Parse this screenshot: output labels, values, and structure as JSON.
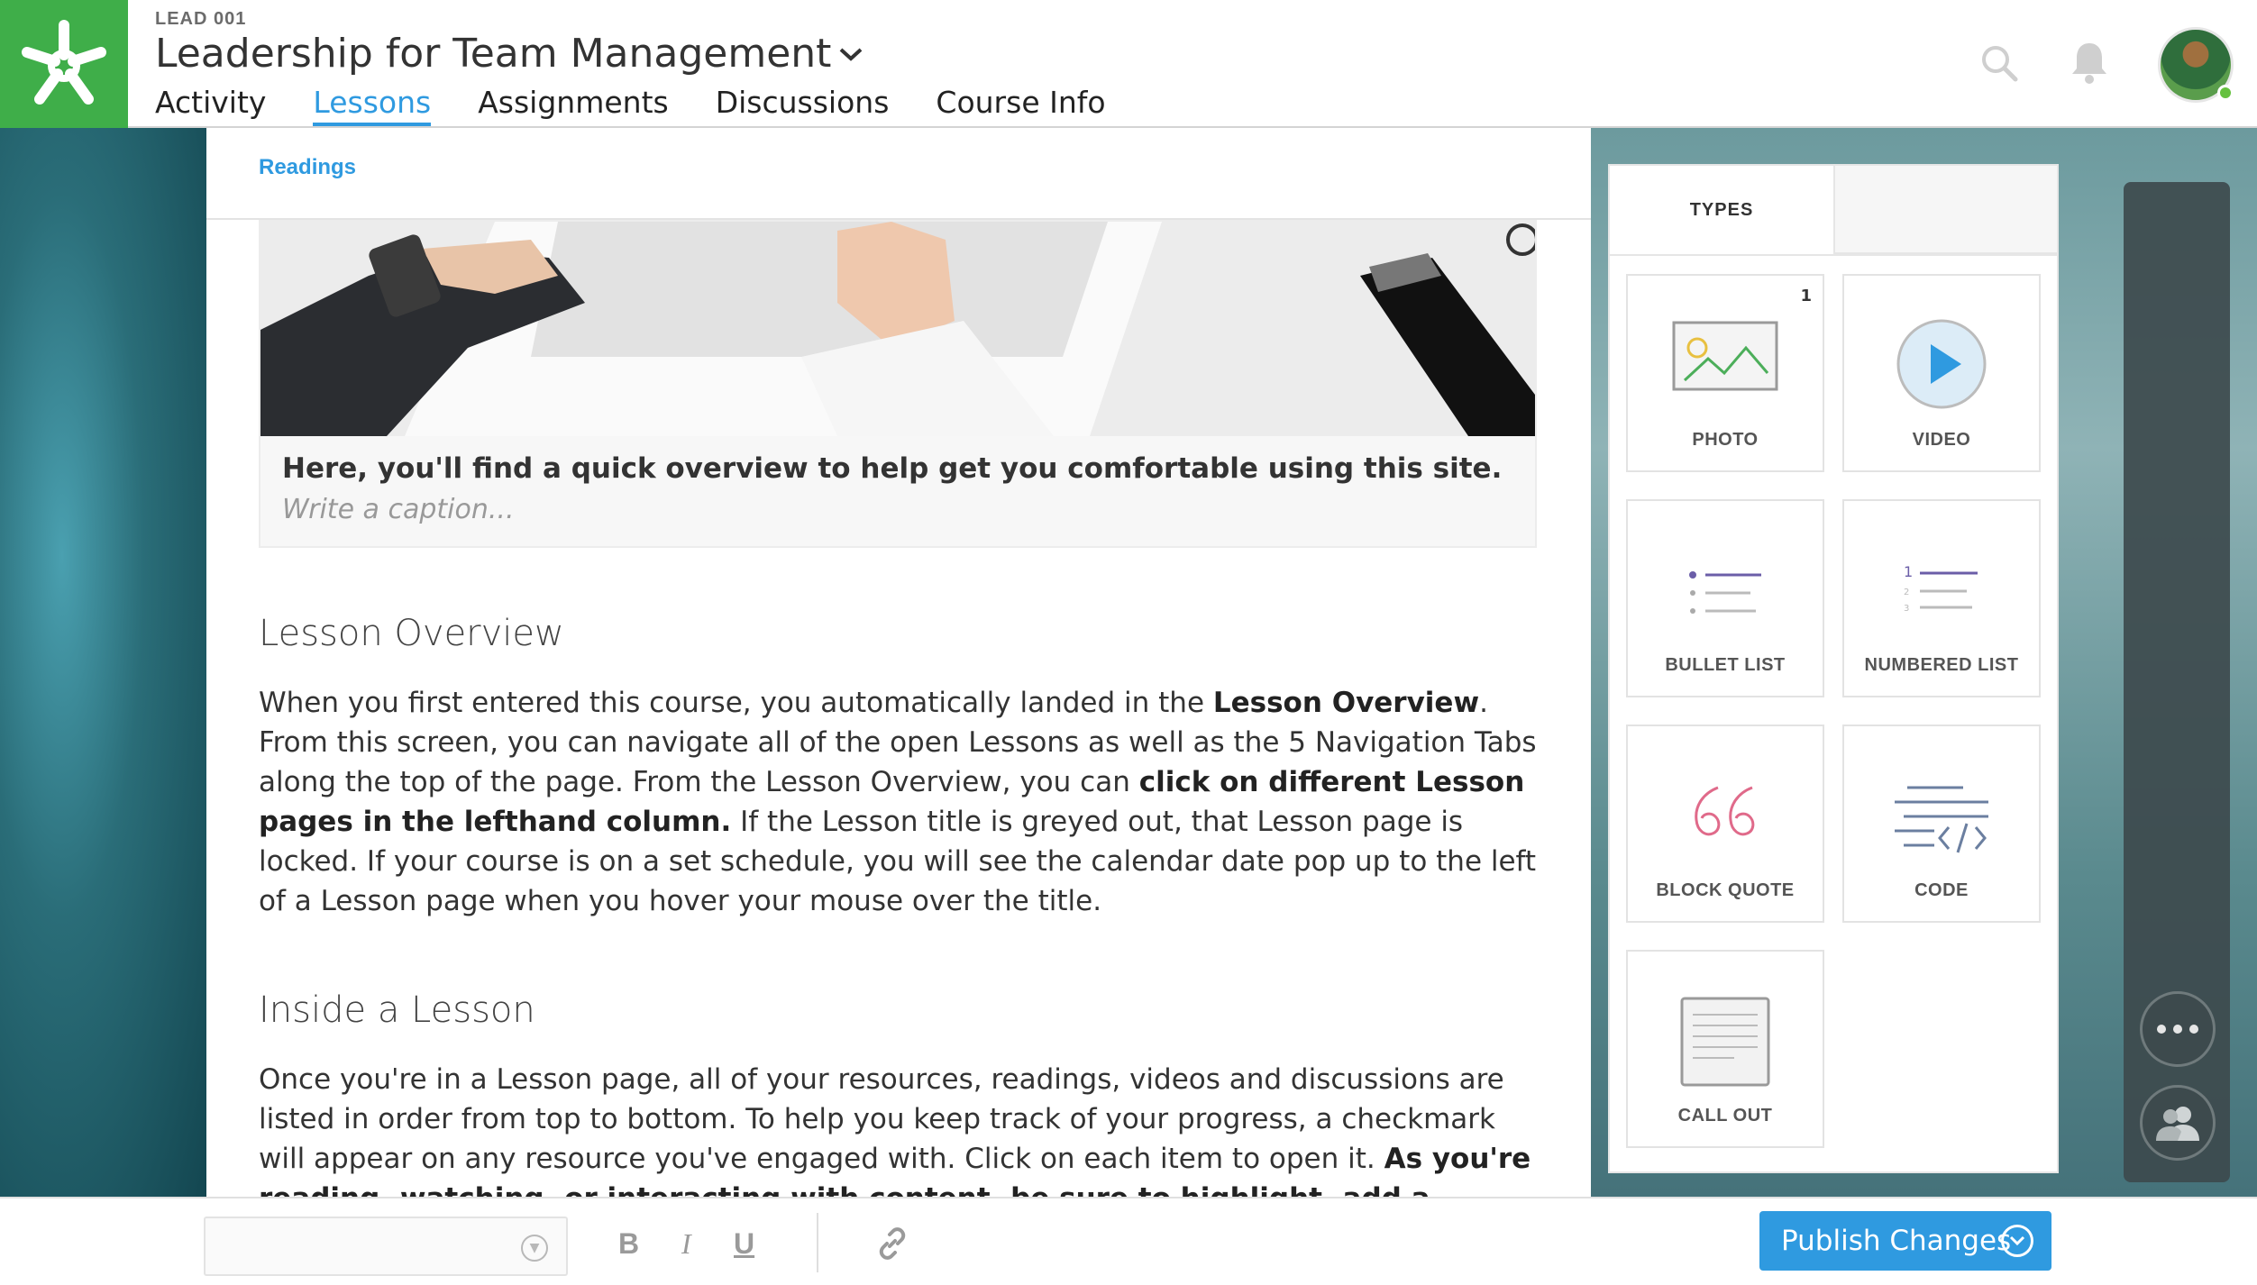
{
  "header": {
    "course_code": "LEAD 001",
    "course_title": "Leadership for Team Management",
    "tabs": [
      {
        "label": "Activity"
      },
      {
        "label": "Lessons"
      },
      {
        "label": "Assignments"
      },
      {
        "label": "Discussions"
      },
      {
        "label": "Course Info"
      }
    ],
    "active_tab": "Lessons"
  },
  "breadcrumb": "Readings",
  "image_card": {
    "caption": "Here, you'll find a quick overview to help get you comfortable using this site.",
    "caption_placeholder": "Write a caption..."
  },
  "sections": [
    {
      "title": "Lesson Overview",
      "p1": "When you first entered this course, you automatically landed in the ",
      "b1": "Lesson Overview",
      "p2": ". From this screen, you can navigate all of the open Lessons as well as the 5 Navigation Tabs along the top of the page. From the Lesson Overview, you can ",
      "b2": "click on different Lesson pages in the lefthand column.",
      "p3": " If the Lesson title is greyed out, that Lesson page is locked. If your course is on a set schedule, you will see the calendar date pop up to the left of a Lesson page when you hover your mouse over the title."
    },
    {
      "title": "Inside a Lesson",
      "p1": "Once you're in a Lesson page, all of your resources, readings, videos and discussions are listed in order from top to bottom. To help you keep track of your progress, a checkmark will appear on any resource you've engaged with. Click on each item to open it. ",
      "b1": "As you're reading, watching, or interacting with content, be sure to highlight, add a comment or question"
    }
  ],
  "types_panel": {
    "tab_label": "TYPES",
    "tiles": [
      {
        "label": "PHOTO",
        "count": "1",
        "icon": "photo-icon"
      },
      {
        "label": "VIDEO",
        "icon": "video-play-icon"
      },
      {
        "label": "BULLET LIST",
        "icon": "bullet-list-icon"
      },
      {
        "label": "NUMBERED LIST",
        "icon": "numbered-list-icon"
      },
      {
        "label": "BLOCK QUOTE",
        "icon": "quote-icon"
      },
      {
        "label": "CODE",
        "icon": "code-icon"
      },
      {
        "label": "CALL OUT",
        "icon": "callout-icon"
      }
    ]
  },
  "toolbar": {
    "bold": "B",
    "italic": "I",
    "underline": "U",
    "publish_label": "Publish Changes"
  },
  "colors": {
    "brand_green": "#3fae49",
    "accent_blue": "#2f9ae0",
    "quote_pink": "#e06a8a"
  }
}
